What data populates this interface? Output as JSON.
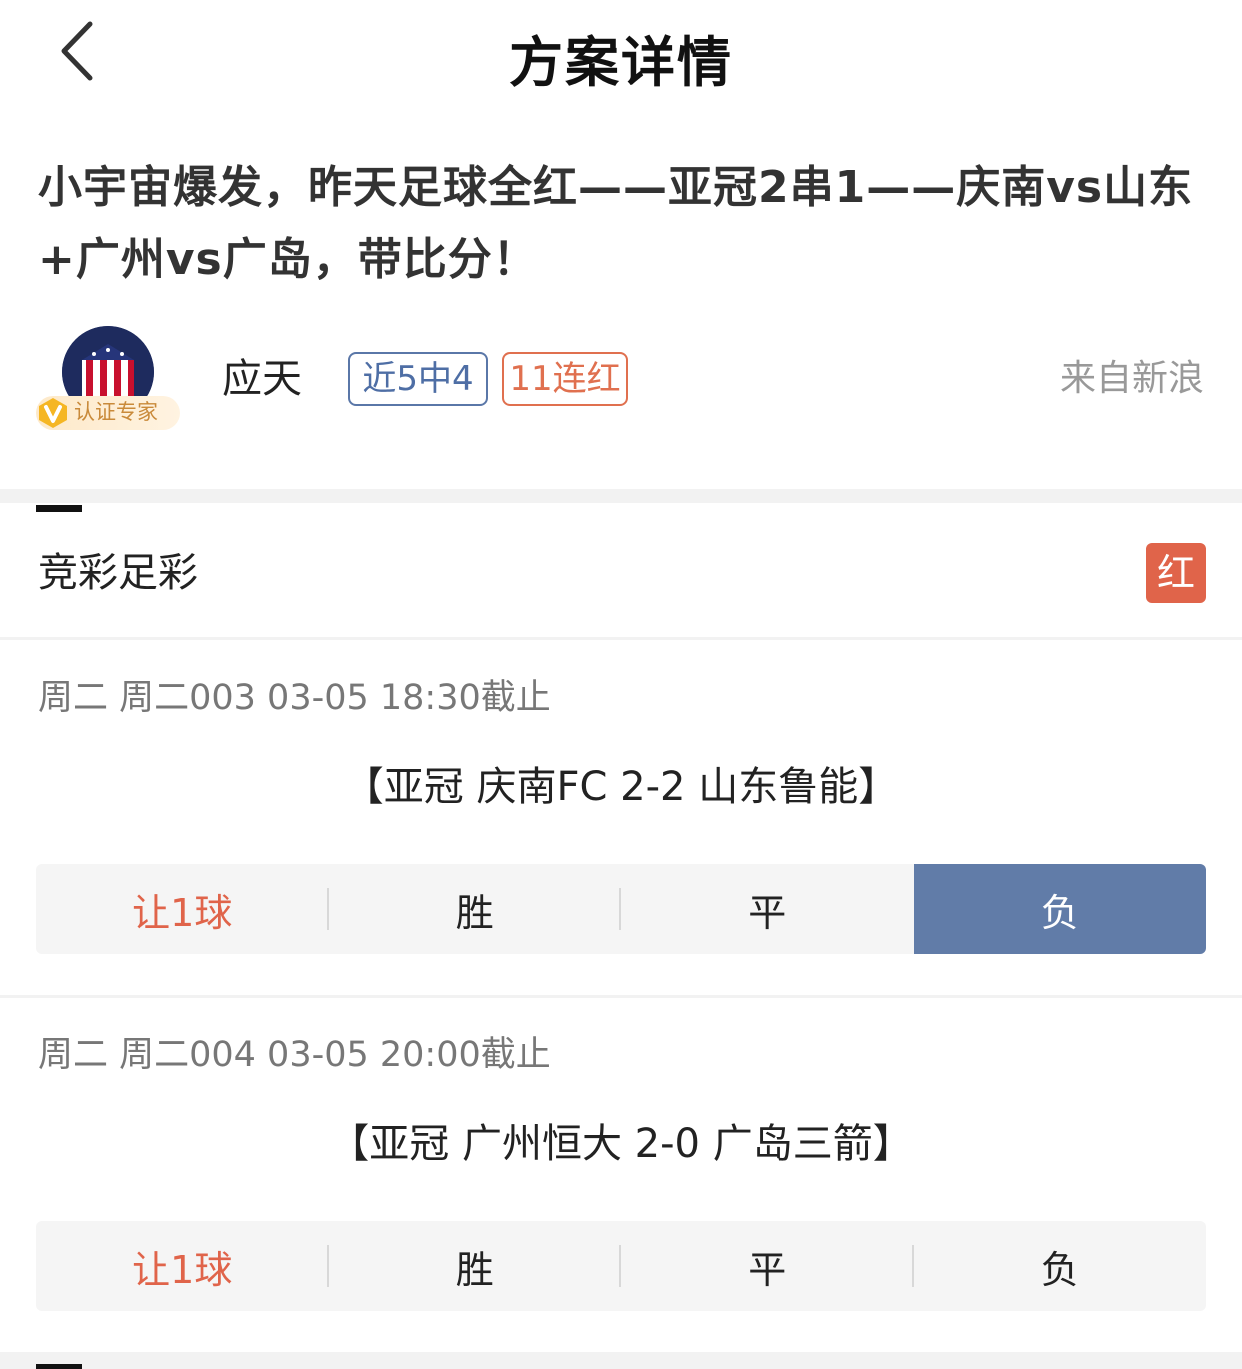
{
  "nav": {
    "title": "方案详情",
    "back_icon": "chevron-left-icon"
  },
  "headline": "小宇宙爆发，昨天足球全红——亚冠2串1——庆南vs山东+广州vs广岛，带比分！",
  "author": {
    "name": "应天",
    "badge": "认证专家",
    "tags": [
      "近5中4",
      "11连红"
    ],
    "source": "来自新浪"
  },
  "section": {
    "title": "竞彩足彩",
    "result": "红"
  },
  "matches": [
    {
      "time": "周二 周二003 03-05 18:30截止",
      "name": "【亚冠 庆南FC 2-2 山东鲁能】",
      "options": [
        "让1球",
        "胜",
        "平",
        "负"
      ],
      "selected": "负"
    },
    {
      "time": "周二 周二004 03-05 20:00截止",
      "name": "【亚冠 广州恒大 2-0 广岛三箭】",
      "options": [
        "让1球",
        "胜",
        "平",
        "负"
      ],
      "selected": ""
    }
  ],
  "colors": {
    "accent_red": "#e0644a",
    "selected_blue": "#617ca8",
    "tag_blue": "#4e6ea5"
  }
}
